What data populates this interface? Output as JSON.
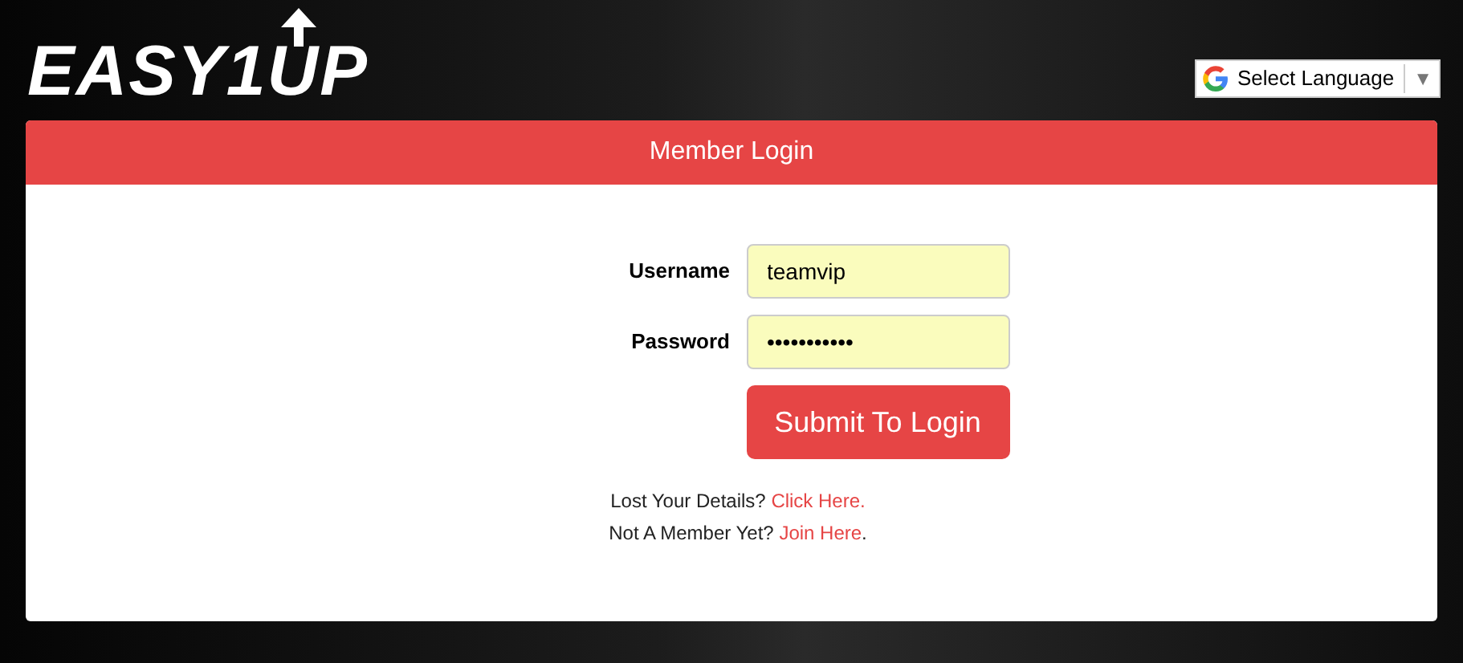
{
  "logo": {
    "text": "EASY1UP"
  },
  "language": {
    "label": "Select Language",
    "caret": "▼"
  },
  "panel": {
    "title": "Member Login"
  },
  "form": {
    "fields": [
      {
        "label": "Username",
        "value": "teamvip"
      },
      {
        "label": "Password",
        "value": "•••••••••••"
      }
    ],
    "submit": "Submit To Login"
  },
  "links": [
    {
      "prefix": "Lost Your Details?",
      "link": "Click Here."
    },
    {
      "prefix": "Not A Member Yet?",
      "link": "Join Here",
      "suffix": "."
    }
  ]
}
